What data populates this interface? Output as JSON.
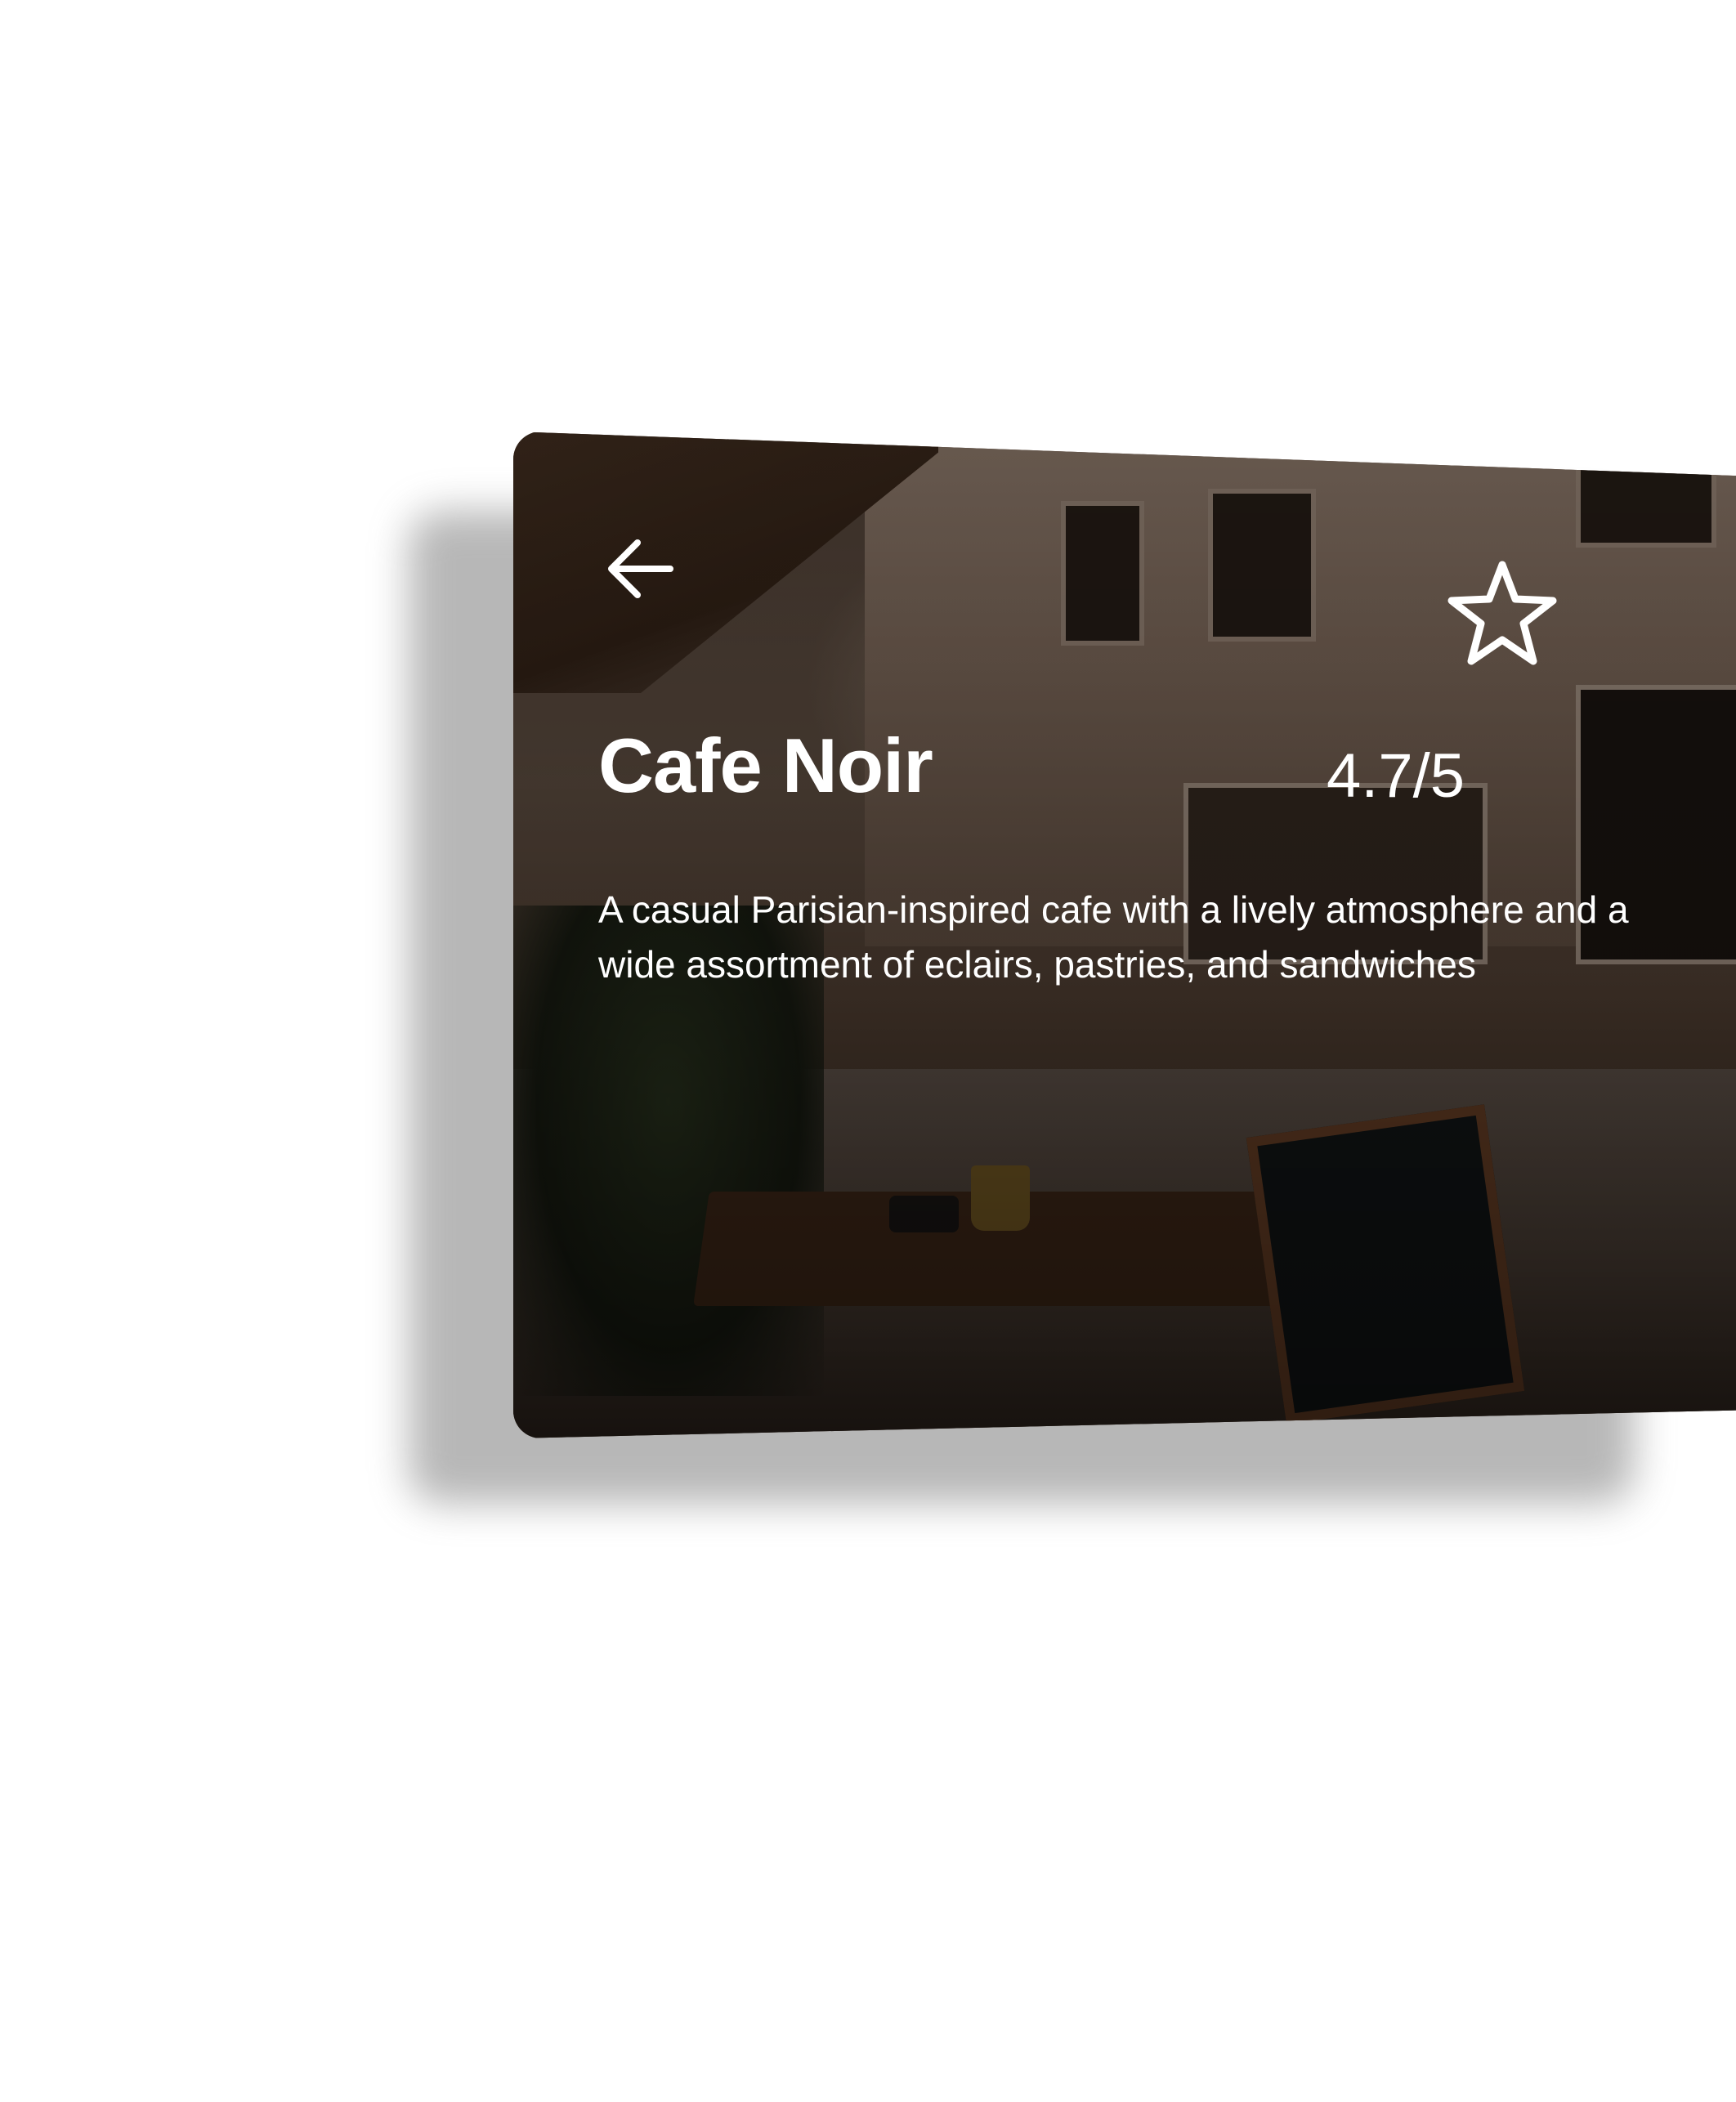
{
  "place": {
    "name": "Cafe Noir",
    "rating": "4.7/5",
    "description": "A casual Parisian-inspired cafe with a lively atmosphere and a wide assortment of eclairs, pastries, and sandwiches"
  },
  "icons": {
    "back": "arrow-left-icon",
    "favorite": "star-outline-icon"
  },
  "colors": {
    "text": "#ffffff",
    "overlay": "#000000"
  }
}
